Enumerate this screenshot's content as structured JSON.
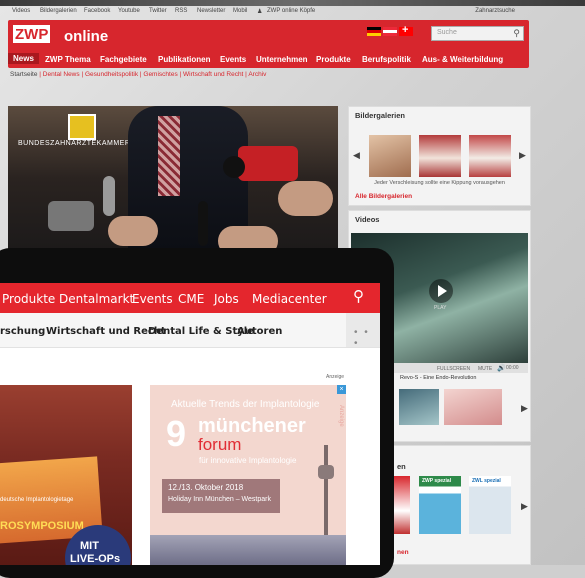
{
  "utility_links": [
    "Videos",
    "Bildergalerien",
    "Facebook",
    "Youtube",
    "Twitter",
    "RSS",
    "Newsletter",
    "Mobil",
    "ZWP online Köpfe"
  ],
  "utility_right": "Zahnarztsuche",
  "logo": {
    "zwp": "ZWP",
    "online": "online"
  },
  "search": {
    "placeholder": "Suche"
  },
  "main_nav": [
    "News",
    "ZWP Thema",
    "Fachgebiete",
    "Publikationen",
    "Events",
    "Unternehmen",
    "Produkte",
    "Berufspolitik",
    "Aus- & Weiterbildung"
  ],
  "sub_nav": [
    "Startseite",
    "Dental News",
    "Gesundheitspolitik",
    "Gemischtes",
    "Wirtschaft und Recht",
    "Archiv"
  ],
  "hero": {
    "logo_text": "BUNDESZAHNÄRZTEKAMMER"
  },
  "gallery": {
    "title": "Bildergalerien",
    "caption": "Jeder Verschleisung sollte eine Kippung vorausgehen",
    "link": "Alle Bildergalerien"
  },
  "videos": {
    "title": "Videos",
    "play_label": "PLAY",
    "time": "00:00",
    "fullscreen": "FULLSCREEN",
    "mute": "MUTE",
    "video_title": "Revo-S - Eine Endo-Revolution"
  },
  "magazines": {
    "title_fragment": "en",
    "link_fragment": "nen",
    "mag1": "ZWP spezial",
    "mag2": "ZWL spezial"
  },
  "front_nav": [
    "Produkte",
    "Dentalmarkt",
    "Events",
    "CME",
    "Jobs",
    "Mediacenter"
  ],
  "front_subnav": [
    "rschung",
    "Wirtschaft und Recht",
    "Dental Life & Style",
    "Autoren"
  ],
  "front_more": "• • •",
  "ad_label": "Anzeige",
  "ad_left": {
    "line1": "deutsche Implantologietage",
    "line2": "ROSYMPOSIUM",
    "mit1": "MIT",
    "mit2": "LIVE-OPs"
  },
  "ad_right": {
    "trend": "Aktuelle Trends der Implantologie",
    "nine": "9",
    "muenchener": "münchener",
    "forum": "forum",
    "inno": "für innovative Implantologie",
    "date": "12./13. Oktober 2018",
    "venue": "Holiday Inn München – Westpark",
    "side": "Anzeige"
  }
}
